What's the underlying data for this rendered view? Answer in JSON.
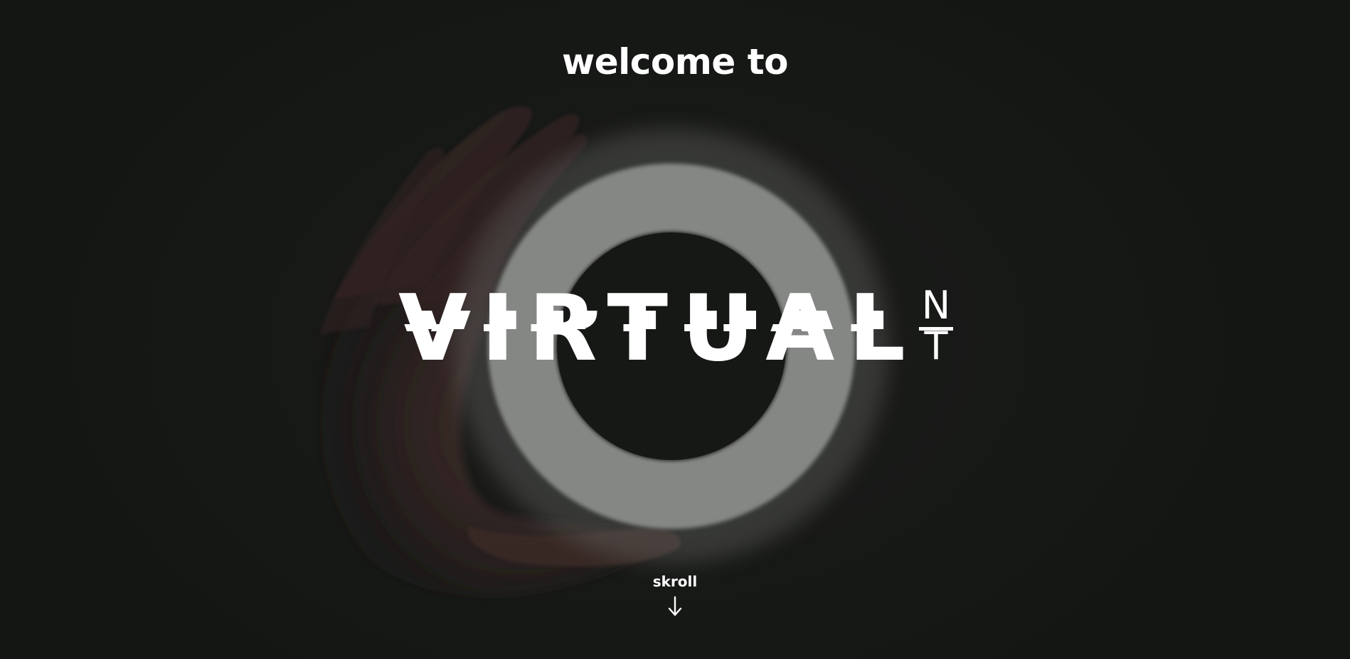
{
  "hero": {
    "welcome_text": "welcome to",
    "logo": {
      "word": "VIRTUAL",
      "suffix_top": "N",
      "suffix_bottom": "T"
    },
    "scroll_label": "skroll",
    "scroll_icon": "arrow-down-icon"
  },
  "colors": {
    "background": "#161815",
    "text": "#ffffff",
    "ring": "#858785",
    "hand": "#3d2b29"
  }
}
